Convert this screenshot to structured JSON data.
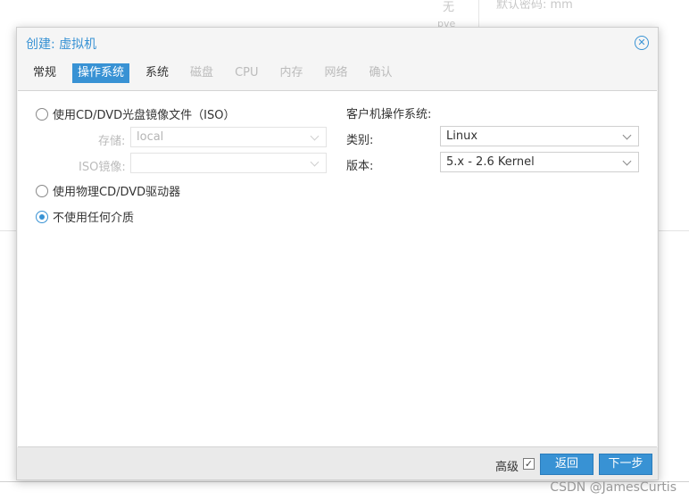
{
  "background": {
    "frag_wu": "无",
    "frag_pve": "pve",
    "frag_password": "默认密码: mm"
  },
  "dialog": {
    "title": "创建: 虚拟机",
    "tabs": [
      {
        "label": "常规",
        "state": "normal"
      },
      {
        "label": "操作系统",
        "state": "active"
      },
      {
        "label": "系统",
        "state": "normal"
      },
      {
        "label": "磁盘",
        "state": "disabled"
      },
      {
        "label": "CPU",
        "state": "disabled"
      },
      {
        "label": "内存",
        "state": "disabled"
      },
      {
        "label": "网络",
        "state": "disabled"
      },
      {
        "label": "确认",
        "state": "disabled"
      }
    ],
    "media": {
      "option_iso": "使用CD/DVD光盘镜像文件（ISO）",
      "storage_label": "存储:",
      "storage_value": "local",
      "iso_label": "ISO镜像:",
      "iso_value": "",
      "option_physical": "使用物理CD/DVD驱动器",
      "option_none": "不使用任何介质",
      "selected": "none"
    },
    "guest_os": {
      "heading": "客户机操作系统:",
      "type_label": "类别:",
      "type_value": "Linux",
      "version_label": "版本:",
      "version_value": "5.x - 2.6 Kernel"
    },
    "footer": {
      "advanced_label": "高级",
      "advanced_checked": true,
      "back_button": "返回",
      "next_button": "下一步"
    }
  },
  "watermark": "CSDN @JamesCurtis",
  "colors": {
    "accent": "#3892d4",
    "disabled_text": "#bbbbbb"
  }
}
